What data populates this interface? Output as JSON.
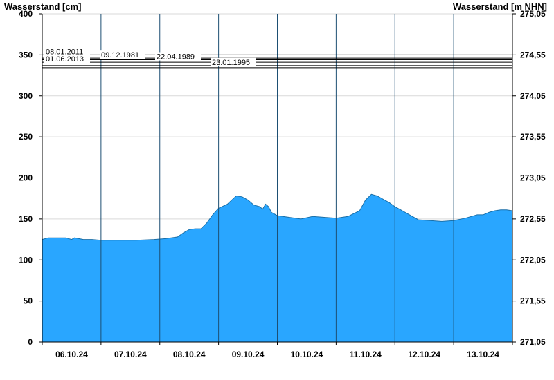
{
  "chart_data": {
    "type": "area",
    "ylabel_left": "Wasserstand [cm]",
    "ylabel_right": "Wasserstand [m NHN]",
    "ylim": [
      0,
      400
    ],
    "yticks": [
      0,
      50,
      100,
      150,
      200,
      250,
      300,
      350,
      400
    ],
    "yticks_right": [
      "271,05",
      "271,55",
      "272,05",
      "272,55",
      "273,05",
      "273,55",
      "274,05",
      "274,55",
      "275,05"
    ],
    "x_categories": [
      "06.10.24",
      "07.10.24",
      "08.10.24",
      "09.10.24",
      "10.10.24",
      "11.10.24",
      "12.10.24",
      "13.10.24"
    ],
    "x_range_days": [
      0,
      8
    ],
    "grid": true,
    "fill_color": "#29a6ff",
    "series": [
      {
        "x": [
          0,
          0.1,
          0.2,
          0.4,
          0.5,
          0.55,
          0.7,
          0.85,
          1.0,
          1.3,
          1.6,
          1.9,
          2.1,
          2.3,
          2.4,
          2.5,
          2.6,
          2.7,
          2.8,
          2.9,
          3.0,
          3.15,
          3.3,
          3.4,
          3.5,
          3.6,
          3.7,
          3.75,
          3.8,
          3.85,
          3.9,
          4.0,
          4.2,
          4.4,
          4.6,
          4.8,
          5.0,
          5.2,
          5.4,
          5.5,
          5.6,
          5.7,
          5.8,
          5.9,
          6.0,
          6.2,
          6.4,
          6.6,
          6.8,
          7.0,
          7.2,
          7.4,
          7.5,
          7.6,
          7.7,
          7.8,
          7.9,
          8.0
        ],
        "y": [
          125,
          127,
          127,
          127,
          125,
          127,
          125,
          125,
          124,
          124,
          124,
          125,
          126,
          128,
          133,
          137,
          138,
          138,
          145,
          155,
          163,
          168,
          178,
          177,
          173,
          167,
          165,
          162,
          168,
          165,
          158,
          154,
          152,
          150,
          153,
          152,
          151,
          153,
          160,
          173,
          180,
          178,
          174,
          170,
          165,
          157,
          149,
          148,
          147,
          148,
          151,
          155,
          155,
          158,
          160,
          161,
          161,
          160
        ]
      }
    ],
    "historic_levels": [
      {
        "date": "08.01.2011",
        "value": 350
      },
      {
        "date": "09.12.1981",
        "value": 346
      },
      {
        "date": "22.04.1989",
        "value": 344
      },
      {
        "date": "01.06.2013",
        "value": 341
      },
      {
        "date": "23.01.1995",
        "value": 337
      },
      {
        "date": "",
        "value": 334
      }
    ]
  }
}
